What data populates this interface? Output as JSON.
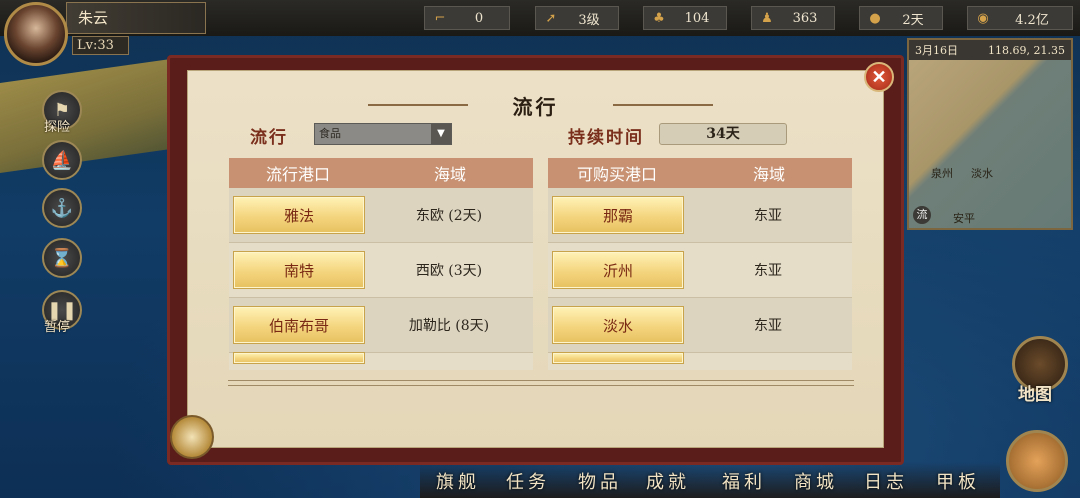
{
  "player": {
    "name": "朱云",
    "level": "Lv:33"
  },
  "stats": [
    {
      "icon": "boot-icon",
      "glyph": "⌐",
      "value": "0"
    },
    {
      "icon": "arrow-up-icon",
      "glyph": "➚",
      "value": "3级"
    },
    {
      "icon": "sailors-icon",
      "glyph": "♣",
      "value": "104"
    },
    {
      "icon": "captain-icon",
      "glyph": "♟",
      "value": "363"
    },
    {
      "icon": "bread-icon",
      "glyph": "●",
      "value": "2天"
    },
    {
      "icon": "coin-icon",
      "glyph": "◉",
      "value": "4.2亿"
    }
  ],
  "side_menu": [
    {
      "label": "探险"
    },
    {
      "label": ""
    },
    {
      "label": ""
    },
    {
      "label": ""
    },
    {
      "label": "暂停"
    }
  ],
  "minimap": {
    "date": "3月16日",
    "coords": "118.69, 21.35",
    "labels": {
      "a": "泉州",
      "b": "淡水",
      "c": "安平",
      "d": "流"
    }
  },
  "dialog": {
    "title": "流行",
    "filter_label": "流行",
    "filter_value": "食品",
    "duration_label": "持续时间",
    "duration_value": "34天",
    "left_table": {
      "headers": [
        "流行港口",
        "海域"
      ],
      "rows": [
        {
          "port": "雅法",
          "region": "东欧 (2天)"
        },
        {
          "port": "南特",
          "region": "西欧 (3天)"
        },
        {
          "port": "伯南布哥",
          "region": "加勒比 (8天)"
        }
      ]
    },
    "right_table": {
      "headers": [
        "可购买港口",
        "海域"
      ],
      "rows": [
        {
          "port": "那霸",
          "region": "东亚"
        },
        {
          "port": "沂州",
          "region": "东亚"
        },
        {
          "port": "淡水",
          "region": "东亚"
        }
      ]
    }
  },
  "bottom_nav": [
    "旗舰",
    "任务",
    "物品",
    "成就",
    "福利",
    "商城",
    "日志",
    "甲板"
  ],
  "map_button": "地图"
}
